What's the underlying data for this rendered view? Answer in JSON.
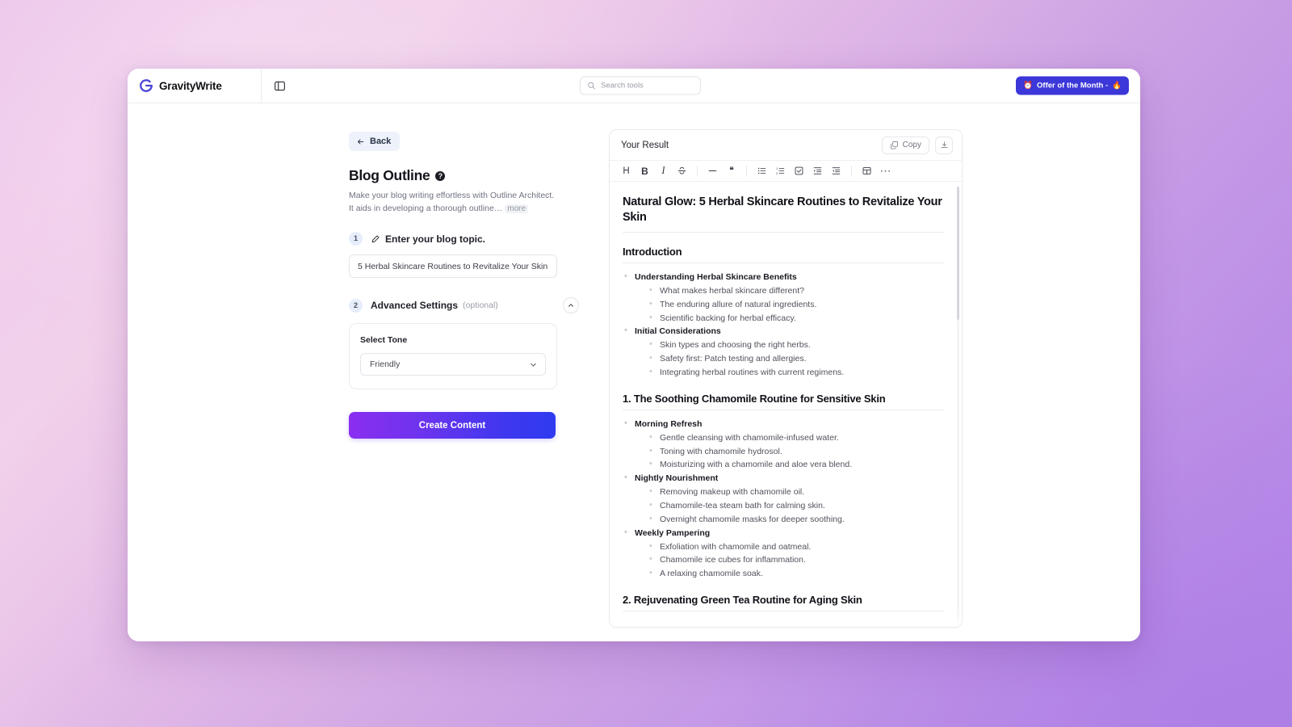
{
  "topbar": {
    "brand": "GravityWrite",
    "panel_toggle_icon": "panel-layout-icon",
    "search": {
      "placeholder": "Search tools",
      "value": ""
    },
    "offer_button": {
      "label": "Offer of the Month -",
      "lead_emoji": "⏰",
      "trail_emoji": "🔥"
    }
  },
  "form": {
    "back_label": "Back",
    "title": "Blog Outline",
    "help_glyph": "?",
    "description": "Make your blog writing effortless with Outline Architect. It aids in developing a thorough outline…",
    "more_label": "more",
    "step1": {
      "number": "1",
      "icon": "pencil-icon",
      "label": "Enter your blog topic.",
      "input_value": "5 Herbal Skincare Routines to Revitalize Your Skin",
      "input_placeholder": "Enter your blog topic"
    },
    "step2": {
      "number": "2",
      "label": "Advanced Settings",
      "optional": "(optional)",
      "collapse_icon": "chevron-up-icon",
      "tone_label": "Select Tone",
      "tone_value": "Friendly",
      "tone_caret": "chevron-down-icon"
    },
    "submit_label": "Create Content"
  },
  "result": {
    "title": "Your Result",
    "copy_label": "Copy",
    "download_icon": "download-icon",
    "toolbar": [
      {
        "name": "heading",
        "glyph": "H"
      },
      {
        "name": "bold",
        "glyph": "B"
      },
      {
        "name": "italic",
        "glyph": "I"
      },
      {
        "name": "strikethrough",
        "glyph": "S"
      },
      {
        "name": "horizontal-rule",
        "glyph": "—"
      },
      {
        "name": "blockquote",
        "glyph": "❝"
      },
      {
        "name": "bullet-list",
        "glyph": ""
      },
      {
        "name": "ordered-list",
        "glyph": ""
      },
      {
        "name": "check-list",
        "glyph": ""
      },
      {
        "name": "indent",
        "glyph": ""
      },
      {
        "name": "outdent",
        "glyph": ""
      },
      {
        "name": "table",
        "glyph": ""
      },
      {
        "name": "more-options",
        "glyph": "⋯"
      }
    ],
    "document": {
      "h1": "Natural Glow: 5 Herbal Skincare Routines to Revitalize Your Skin",
      "sections": [
        {
          "heading": "Introduction",
          "groups": [
            {
              "title": "Understanding Herbal Skincare Benefits",
              "items": [
                "What makes herbal skincare different?",
                "The enduring allure of natural ingredients.",
                "Scientific backing for herbal efficacy."
              ]
            },
            {
              "title": "Initial Considerations",
              "items": [
                "Skin types and choosing the right herbs.",
                "Safety first: Patch testing and allergies.",
                "Integrating herbal routines with current regimens."
              ]
            }
          ]
        },
        {
          "heading": "1. The Soothing Chamomile Routine for Sensitive Skin",
          "groups": [
            {
              "title": "Morning Refresh",
              "items": [
                "Gentle cleansing with chamomile-infused water.",
                "Toning with chamomile hydrosol.",
                "Moisturizing with a chamomile and aloe vera blend."
              ]
            },
            {
              "title": "Nightly Nourishment",
              "items": [
                "Removing makeup with chamomile oil.",
                "Chamomile-tea steam bath for calming skin.",
                "Overnight chamomile masks for deeper soothing."
              ]
            },
            {
              "title": "Weekly Pampering",
              "items": [
                "Exfoliation with chamomile and oatmeal.",
                "Chamomile ice cubes for inflammation.",
                "A relaxing chamomile soak."
              ]
            }
          ]
        },
        {
          "heading": "2. Rejuvenating Green Tea Routine for Aging Skin",
          "groups": []
        }
      ]
    }
  },
  "colors": {
    "brand_purple": "#4a45d6",
    "offer_blue": "#3b37d8",
    "cta_gradient_from": "#8b2ef0",
    "cta_gradient_to": "#2f3bf0",
    "step_badge_bg": "#e6edfb",
    "back_bg": "#eef2fb"
  }
}
